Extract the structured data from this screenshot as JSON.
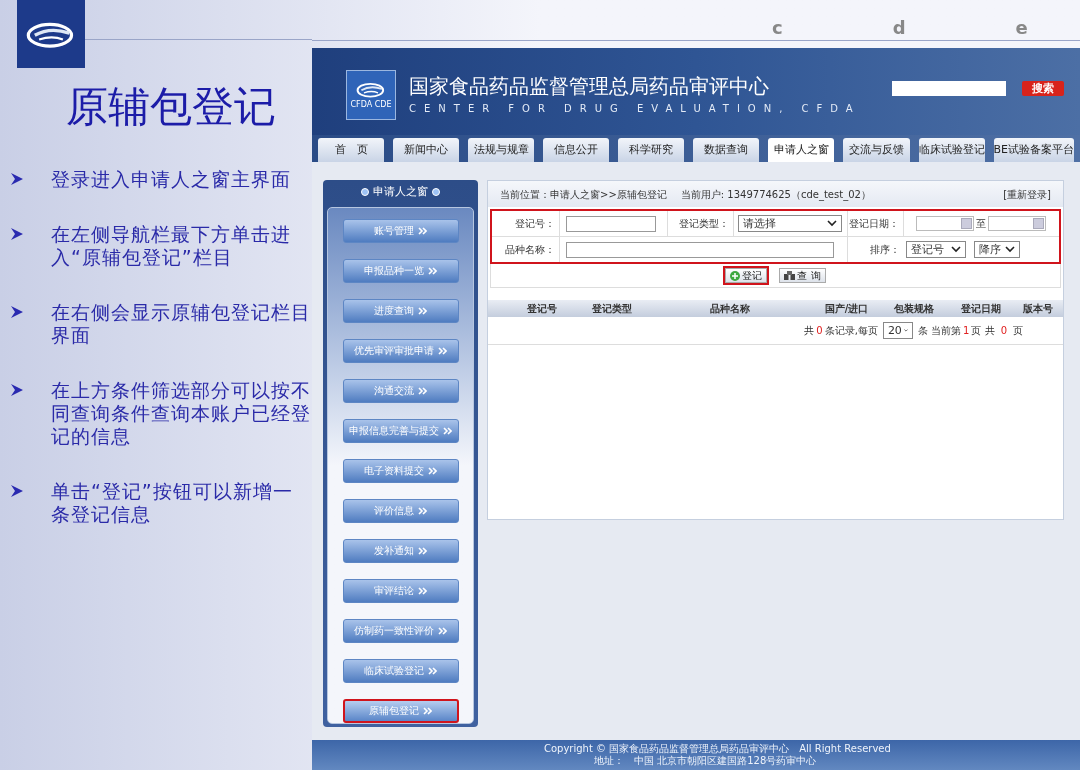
{
  "slide": {
    "title": "原辅包登记",
    "decor_letters": [
      "c",
      "d",
      "e"
    ],
    "bullets": [
      "登录进入申请人之窗主界面",
      "在左侧导航栏最下方单击进入“原辅包登记”栏目",
      "在右侧会显示原辅包登记栏目界面",
      "在上方条件筛选部分可以按不同查询条件查询本账户已经登记的信息",
      "单击“登记”按钮可以新增一条登记信息"
    ]
  },
  "site": {
    "name": "国家食品药品监督管理总局药品审评中心",
    "name_en": "CENTER FOR DRUG EVALUATION, CFDA",
    "logo_caption": "CFDA CDE",
    "search_button": "搜索",
    "nav_tabs": [
      {
        "label": "首　页",
        "selected": false
      },
      {
        "label": "新闻中心",
        "selected": false
      },
      {
        "label": "法规与规章",
        "selected": false
      },
      {
        "label": "信息公开",
        "selected": false
      },
      {
        "label": "科学研究",
        "selected": false
      },
      {
        "label": "数据查询",
        "selected": false
      },
      {
        "label": "申请人之窗",
        "selected": true
      },
      {
        "label": "交流与反馈",
        "selected": false
      },
      {
        "label": "临床试验登记",
        "selected": false
      },
      {
        "label": "BE试验备案平台",
        "selected": false
      }
    ]
  },
  "sidebar": {
    "title": "申请人之窗",
    "items": [
      {
        "label": "账号管理",
        "selected": false
      },
      {
        "label": "申报品种一览",
        "selected": false
      },
      {
        "label": "进度查询",
        "selected": false
      },
      {
        "label": "优先审评审批申请",
        "selected": false
      },
      {
        "label": "沟通交流",
        "selected": false
      },
      {
        "label": "申报信息完善与提交",
        "selected": false
      },
      {
        "label": "电子资料提交",
        "selected": false
      },
      {
        "label": "评价信息",
        "selected": false
      },
      {
        "label": "发补通知",
        "selected": false
      },
      {
        "label": "审评结论",
        "selected": false
      },
      {
        "label": "仿制药一致性评价",
        "selected": false
      },
      {
        "label": "临床试验登记",
        "selected": false
      },
      {
        "label": "原辅包登记",
        "selected": true
      }
    ]
  },
  "content": {
    "breadcrumb": "当前位置：申请人之窗>>原辅包登记",
    "current_user": "当前用户: 1349774625（cde_test_02）",
    "relogin": "[重新登录]",
    "filters": {
      "highlighted": true,
      "reg_no_label": "登记号：",
      "type_label": "登记类型：",
      "type_value": "请选择",
      "date_label": "登记日期：",
      "date_to": "至",
      "name_label": "品种名称：",
      "sort_label": "排序：",
      "sort_field": "登记号",
      "sort_order": "降序"
    },
    "buttons": [
      {
        "label": "登记",
        "kind": "add",
        "highlighted": true
      },
      {
        "label": "查 询",
        "kind": "search",
        "highlighted": false
      }
    ],
    "columns": [
      "登记号",
      "登记类型",
      "品种名称",
      "国产/进口",
      "包装规格",
      "登记日期",
      "版本号"
    ],
    "pagination": {
      "t1": "共",
      "total": "0",
      "t2": "条记录,每页",
      "page_size": "20",
      "t3": "条 当前第",
      "current": "1",
      "t4": "页 共",
      "pages": "0",
      "t5": "页"
    }
  },
  "footer": {
    "copyright": "Copyright © 国家食品药品监督管理总局药品审评中心　All Right Reserved",
    "address": "地址：　中国 北京市朝阳区建国路128号药审中心"
  }
}
